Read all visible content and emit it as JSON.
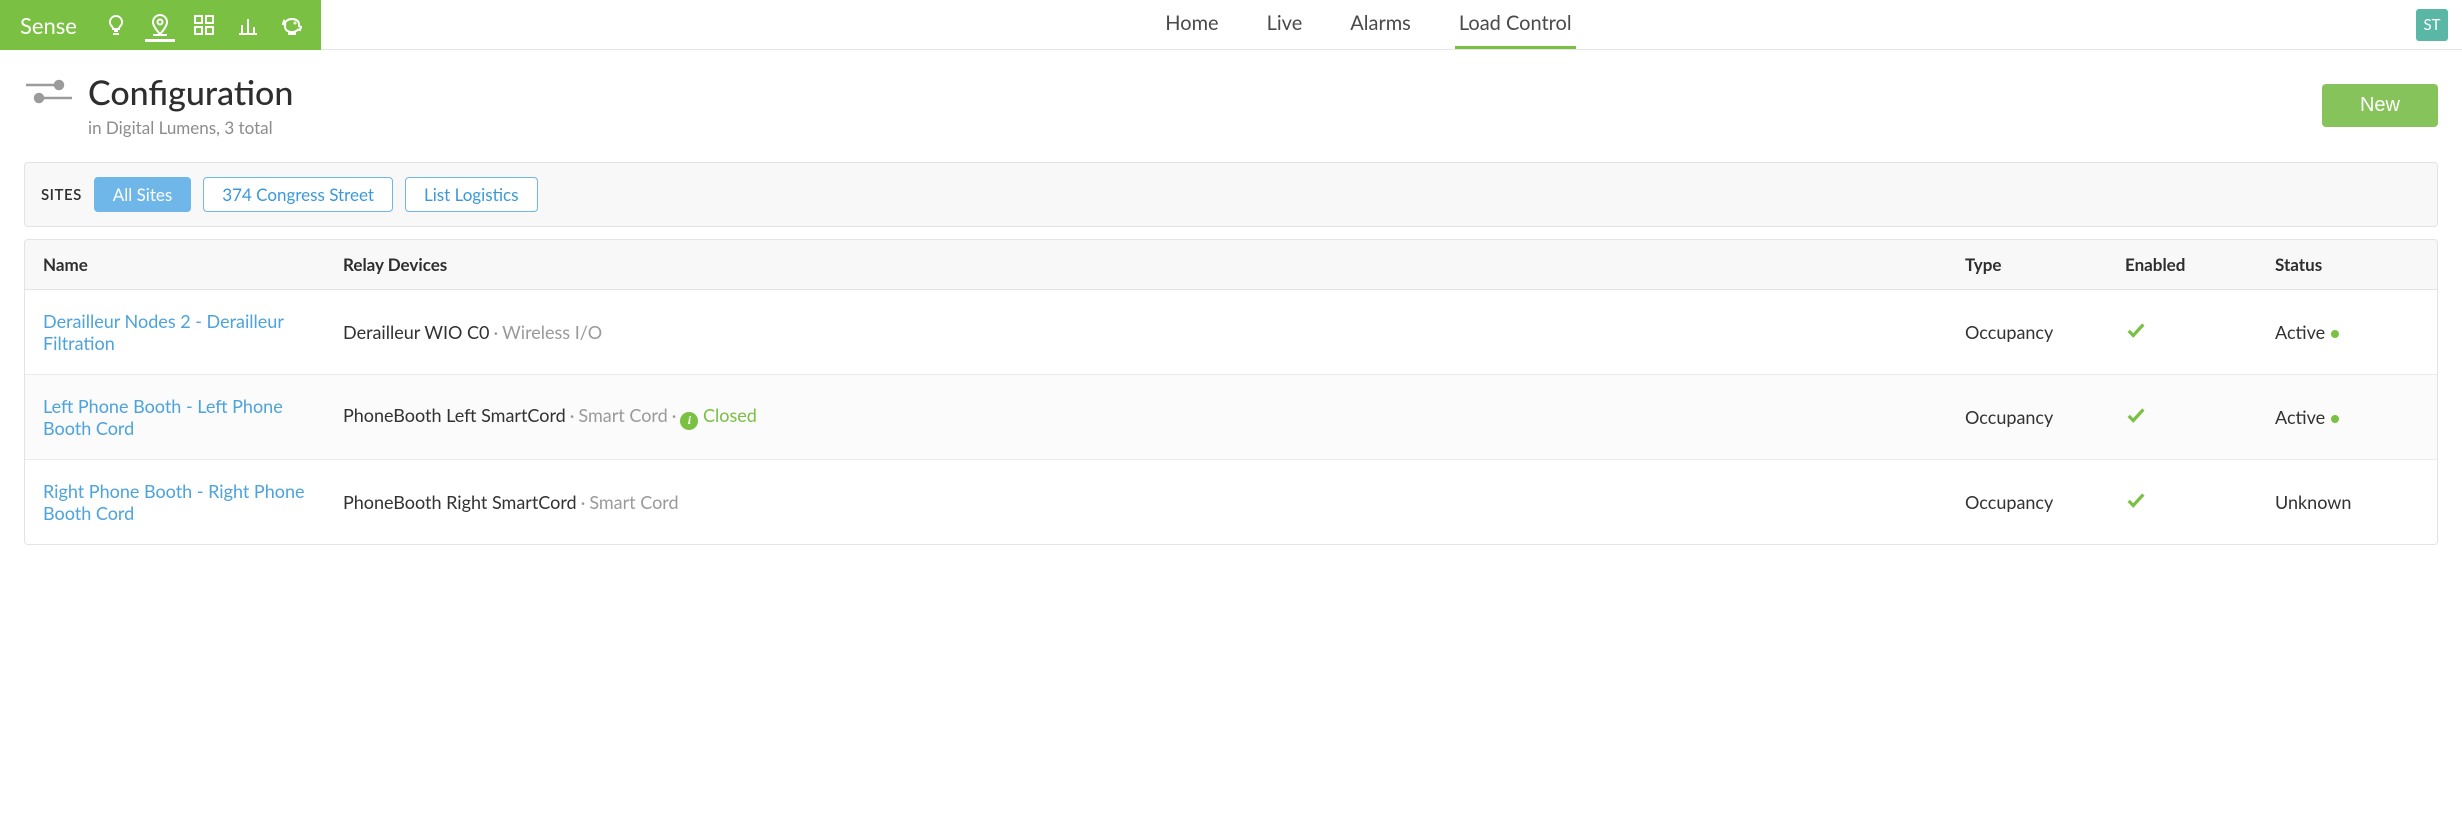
{
  "brand": {
    "name": "Sense"
  },
  "nav": {
    "tabs": [
      "Home",
      "Live",
      "Alarms",
      "Load Control"
    ],
    "active_index": 3
  },
  "user": {
    "initials": "ST"
  },
  "page": {
    "title": "Configuration",
    "subtitle": "in Digital Lumens, 3 total",
    "new_button": "New"
  },
  "filters": {
    "label": "SITES",
    "items": [
      {
        "label": "All Sites",
        "active": true
      },
      {
        "label": "374 Congress Street",
        "active": false
      },
      {
        "label": "List Logistics",
        "active": false
      }
    ]
  },
  "table": {
    "columns": [
      "Name",
      "Relay Devices",
      "Type",
      "Enabled",
      "Status"
    ],
    "rows": [
      {
        "name": "Derailleur Nodes 2 - Derailleur Filtration",
        "relay_primary": "Derailleur WIO C0",
        "relay_secondary": "Wireless I/O",
        "relay_state": null,
        "relay_info": false,
        "type": "Occupancy",
        "enabled": true,
        "status": "Active",
        "status_dot": true
      },
      {
        "name": "Left Phone Booth - Left Phone Booth Cord",
        "relay_primary": "PhoneBooth Left SmartCord",
        "relay_secondary": "Smart Cord",
        "relay_state": "Closed",
        "relay_info": true,
        "type": "Occupancy",
        "enabled": true,
        "status": "Active",
        "status_dot": true
      },
      {
        "name": "Right Phone Booth - Right Phone Booth Cord",
        "relay_primary": "PhoneBooth Right SmartCord",
        "relay_secondary": "Smart Cord",
        "relay_state": null,
        "relay_info": false,
        "type": "Occupancy",
        "enabled": true,
        "status": "Unknown",
        "status_dot": false
      }
    ]
  }
}
